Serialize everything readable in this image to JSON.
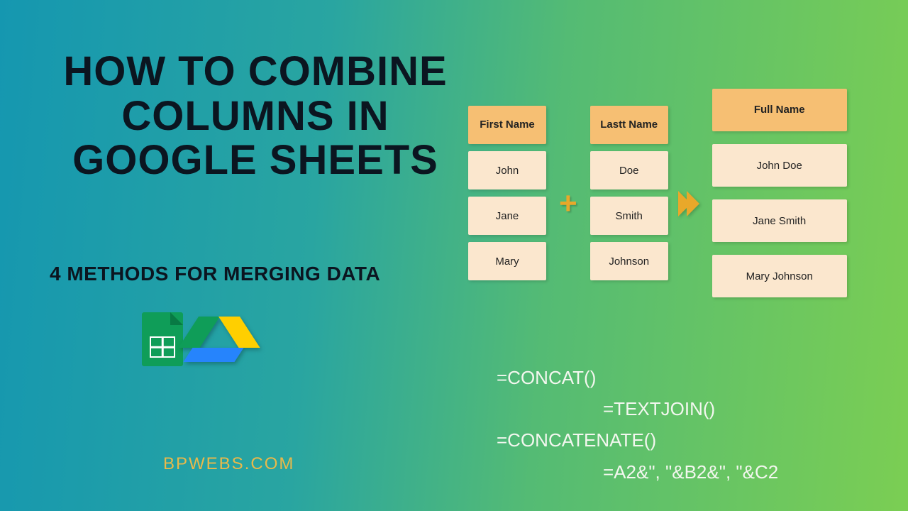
{
  "title": "HOW TO COMBINE COLUMNS IN GOOGLE SHEETS",
  "subtitle": "4 METHODS FOR MERGING DATA",
  "footer_url": "BPWEBS.COM",
  "diagram": {
    "col1": {
      "header": "First Name",
      "rows": [
        "John",
        "Jane",
        "Mary"
      ]
    },
    "plus": "+",
    "col2": {
      "header": "Lastt Name",
      "rows": [
        "Doe",
        "Smith",
        "Johnson"
      ]
    },
    "arrow": "»",
    "col3": {
      "header": "Full Name",
      "rows": [
        "John Doe",
        "Jane Smith",
        "Mary Johnson"
      ]
    }
  },
  "formulas": {
    "l1": "=CONCAT()",
    "l2": "=TEXTJOIN()",
    "l3": "=CONCATENATE()",
    "l4": "=A2&\", \"&B2&\", \"&C2"
  },
  "icons": {
    "sheets": "google-sheets-icon",
    "drive": "google-drive-icon"
  }
}
